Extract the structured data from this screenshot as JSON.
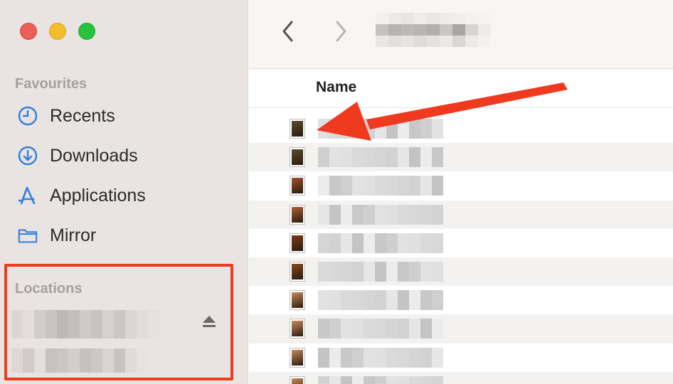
{
  "window": {
    "controls": [
      "close",
      "minimize",
      "zoom"
    ]
  },
  "sidebar": {
    "favourites_title": "Favourites",
    "items": [
      {
        "label": "Recents",
        "icon": "clock-icon"
      },
      {
        "label": "Downloads",
        "icon": "download-icon"
      },
      {
        "label": "Applications",
        "icon": "applications-icon"
      },
      {
        "label": "Mirror",
        "icon": "folder-icon"
      }
    ],
    "locations_title": "Locations",
    "locations_icon": "eject-icon"
  },
  "toolbar": {
    "back_icon": "chevron-left-icon",
    "forward_icon": "chevron-right-icon"
  },
  "list": {
    "name_header": "Name",
    "row_count": 10
  },
  "colors": {
    "highlight": "#f03a1f",
    "accent": "#2f7fe0"
  }
}
